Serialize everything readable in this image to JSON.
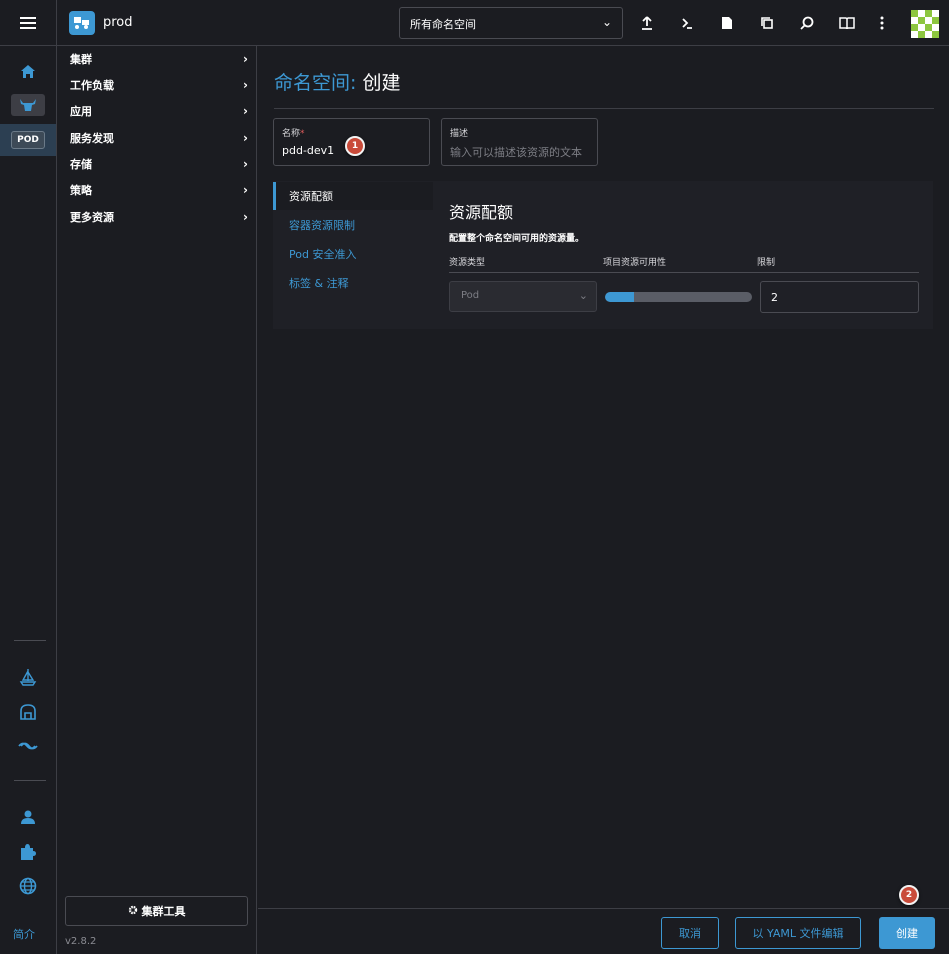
{
  "header": {
    "cluster_name": "prod",
    "namespace_filter": "所有命名空间",
    "toolbar_icons": [
      "upload-icon",
      "terminal-icon",
      "file-icon",
      "copy-icon",
      "search-icon",
      "book-icon",
      "more-vert-icon"
    ]
  },
  "rail": {
    "items": [
      "home-icon",
      "cluster-icon",
      "pod-badge",
      "helm-icon",
      "extensions-icon",
      "fleet-icon",
      "user-icon",
      "puzzle-icon",
      "globe-icon"
    ],
    "pod_label": "POD",
    "about": "简介"
  },
  "sidenav": {
    "items": [
      {
        "label": "集群"
      },
      {
        "label": "工作负载"
      },
      {
        "label": "应用"
      },
      {
        "label": "服务发现"
      },
      {
        "label": "存储"
      },
      {
        "label": "策略"
      },
      {
        "label": "更多资源"
      }
    ],
    "cluster_tools": "集群工具",
    "version": "v2.8.2"
  },
  "page": {
    "title_crumb": "命名空间:",
    "title_action": "创建",
    "name_label": "名称",
    "name_required": "*",
    "name_value": "pdd-dev1",
    "desc_label": "描述",
    "desc_placeholder": "输入可以描述该资源的文本",
    "callout_1": "1",
    "callout_2": "2"
  },
  "tabs": [
    {
      "label": "资源配额",
      "active": true
    },
    {
      "label": "容器资源限制",
      "active": false
    },
    {
      "label": "Pod 安全准入",
      "active": false
    },
    {
      "label": "标签 & 注释",
      "active": false
    }
  ],
  "quota": {
    "title": "资源配额",
    "subtitle": "配置整个命名空间可用的资源量。",
    "col_type": "资源类型",
    "col_availability": "项目资源可用性",
    "col_limit": "限制",
    "type_value": "Pod",
    "availability_fraction": 0.2,
    "limit_value": "2"
  },
  "footer": {
    "cancel": "取消",
    "edit_yaml": "以 YAML 文件编辑",
    "create": "创建"
  },
  "colors": {
    "accent": "#3d98d3",
    "background": "#1b1c21",
    "callout": "#c94b3a"
  }
}
